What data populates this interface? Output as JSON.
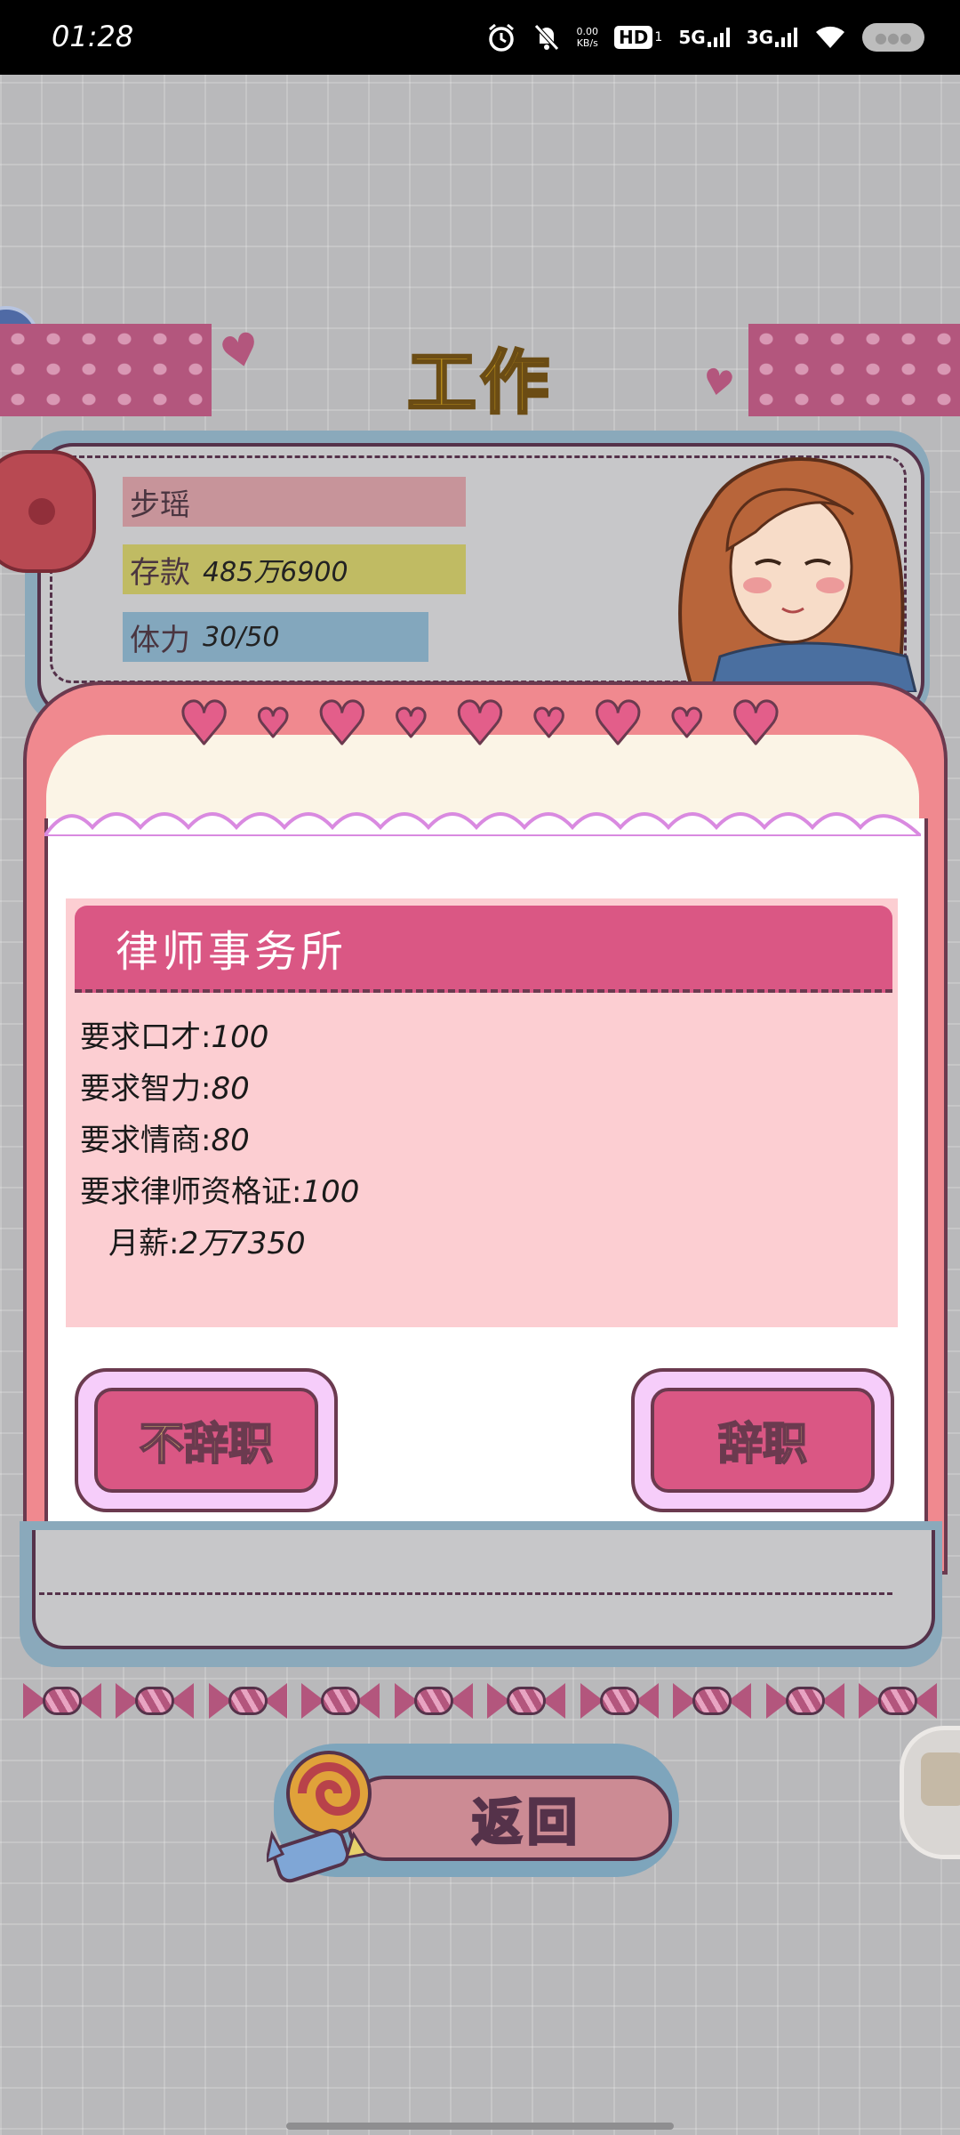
{
  "status_bar": {
    "time": "01:28",
    "net_speed_value": "0.00",
    "net_speed_unit": "KB/s",
    "hd_label": "HD",
    "hd_sub": "1",
    "sig1_label": "5G",
    "sig2_label": "3G",
    "battery_label": "●●●",
    "icons": [
      "alarm-icon",
      "mute-icon",
      "wifi-icon",
      "battery-icon"
    ]
  },
  "header": {
    "title": "工作"
  },
  "player": {
    "name": "步瑶",
    "money_label": "存款",
    "money_value": "485万6900",
    "stamina_label": "体力",
    "stamina_value": "30/50"
  },
  "dialog": {
    "job_title": "律师事务所",
    "requirements": [
      {
        "label": "要求口才:",
        "value": "100"
      },
      {
        "label": "要求智力:",
        "value": "80"
      },
      {
        "label": "要求情商:",
        "value": "80"
      },
      {
        "label": "要求律师资格证:",
        "value": "100"
      }
    ],
    "salary_label": "月薪:",
    "salary_value": "2万7350",
    "buttons": {
      "no_resign": "不辞职",
      "resign": "辞职"
    }
  },
  "back_button": {
    "label": "返回"
  },
  "colors": {
    "accent_pink": "#da5784",
    "title_gold": "#d4a41e",
    "outline": "#6b3a4f"
  }
}
